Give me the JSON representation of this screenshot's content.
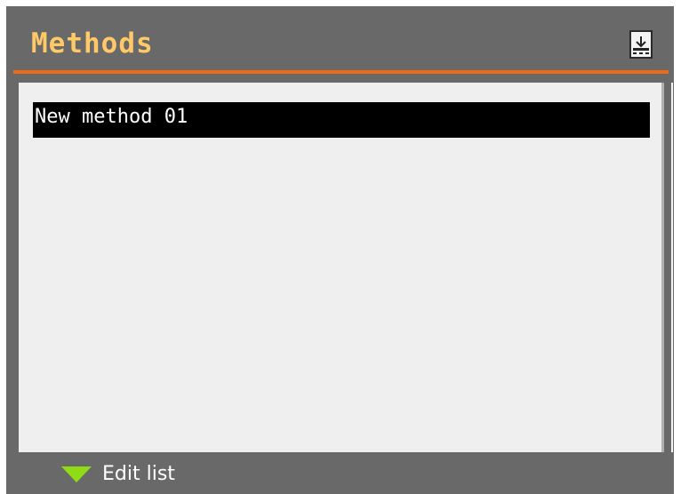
{
  "header": {
    "title": "Methods",
    "icon": "download-to-device-icon"
  },
  "colors": {
    "screen_bg": "#696969",
    "title": "#ffc968",
    "accent_line": "#f06a13",
    "list_bg": "#efefef",
    "selected_row": "#000000",
    "softkey_arrow": "#8fdc16"
  },
  "methods_list": {
    "items": [
      {
        "label": "New method 01",
        "selected": true
      }
    ]
  },
  "footer": {
    "softkey_icon": "down-triangle-icon",
    "softkey_label": "Edit list"
  }
}
